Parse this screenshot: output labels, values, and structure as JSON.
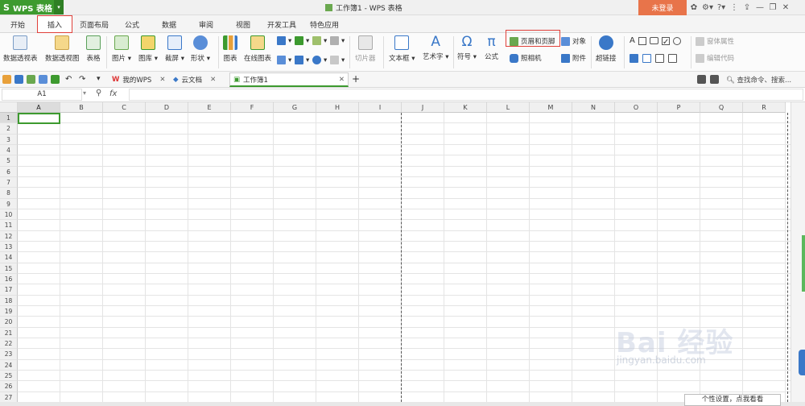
{
  "app": {
    "logo": "WPS 表格",
    "window_title": "工作簿1 - WPS 表格",
    "login": "未登录"
  },
  "ribbon_tabs": [
    "开始",
    "插入",
    "页面布局",
    "公式",
    "数据",
    "审阅",
    "视图",
    "开发工具",
    "特色应用"
  ],
  "ribbon": {
    "pivot_table": "数据透视表",
    "pivot_chart": "数据透视图",
    "table": "表格",
    "picture": "图片 ▾",
    "gallery": "图库 ▾",
    "screenshot": "截屏 ▾",
    "shape": "形状 ▾",
    "chart": "图表",
    "online_chart": "在线图表",
    "slicer": "切片器",
    "textbox": "文本框 ▾",
    "wordart": "艺术字 ▾",
    "symbol": "符号 ▾",
    "formula": "公式",
    "header_footer": "页眉和页脚",
    "object": "对象",
    "camera": "照相机",
    "attachment": "附件",
    "hyperlink": "超链接",
    "form_props": "窗体属性",
    "edit_code": "编辑代码"
  },
  "doc_tabs": {
    "mywps": "我的WPS",
    "cloud": "云文档",
    "current": "工作簿1"
  },
  "search": "查找命令、搜索...",
  "formula_bar": {
    "cell_ref": "A1",
    "fx": "fx",
    "value": ""
  },
  "columns": [
    "A",
    "B",
    "C",
    "D",
    "E",
    "F",
    "G",
    "H",
    "I",
    "J",
    "K",
    "L",
    "M",
    "N",
    "O",
    "P",
    "Q",
    "R"
  ],
  "rows": [
    "1",
    "2",
    "3",
    "4",
    "5",
    "6",
    "7",
    "8",
    "9",
    "10",
    "11",
    "12",
    "13",
    "14",
    "15",
    "16",
    "17",
    "18",
    "19",
    "20",
    "21",
    "22",
    "23",
    "24",
    "25",
    "26",
    "27"
  ],
  "tooltip": "个性设置，点我看看",
  "watermark": {
    "main": "Bai 经验",
    "sub": "jingyan.baidu.com"
  },
  "colors": {
    "accent": "#3d9a2f",
    "login": "#e8744a",
    "highlight": "#e0403a"
  }
}
